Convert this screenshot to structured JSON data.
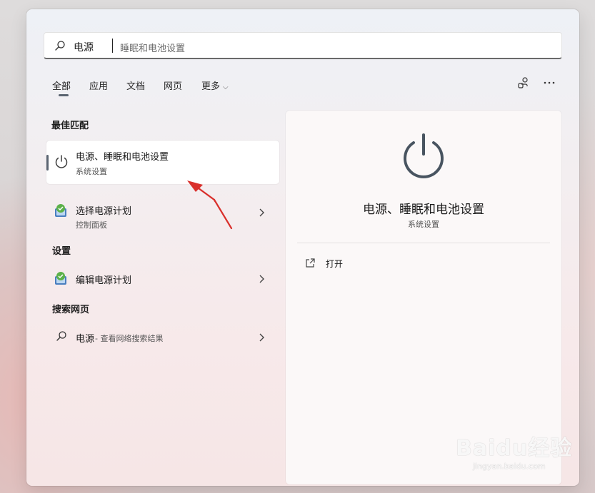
{
  "search": {
    "query": "电源",
    "suggestion": "睡眠和电池设置"
  },
  "tabs": [
    {
      "label": "全部"
    },
    {
      "label": "应用"
    },
    {
      "label": "文档"
    },
    {
      "label": "网页"
    },
    {
      "label": "更多"
    }
  ],
  "sections": {
    "best_match": "最佳匹配",
    "settings": "设置",
    "web": "搜索网页"
  },
  "best_match": {
    "title": "电源、睡眠和电池设置",
    "subtitle": "系统设置",
    "icon": "power-icon"
  },
  "apps": [
    {
      "title": "选择电源计划",
      "subtitle": "控制面板",
      "icon": "power-plan-icon"
    }
  ],
  "settings_items": [
    {
      "title": "编辑电源计划",
      "icon": "power-plan-icon"
    }
  ],
  "web_items": [
    {
      "title": "电源",
      "suffix": " - 查看网络搜索结果",
      "icon": "search-icon"
    }
  ],
  "preview": {
    "title": "电源、睡眠和电池设置",
    "subtitle": "系统设置",
    "actions": [
      {
        "label": "打开",
        "icon": "open-external-icon"
      }
    ]
  },
  "watermark": {
    "logo": "Baidu经验",
    "url": "jingyan.baidu.com"
  },
  "colors": {
    "accent": "#5b6572",
    "annotation_arrow": "#d9302c"
  }
}
